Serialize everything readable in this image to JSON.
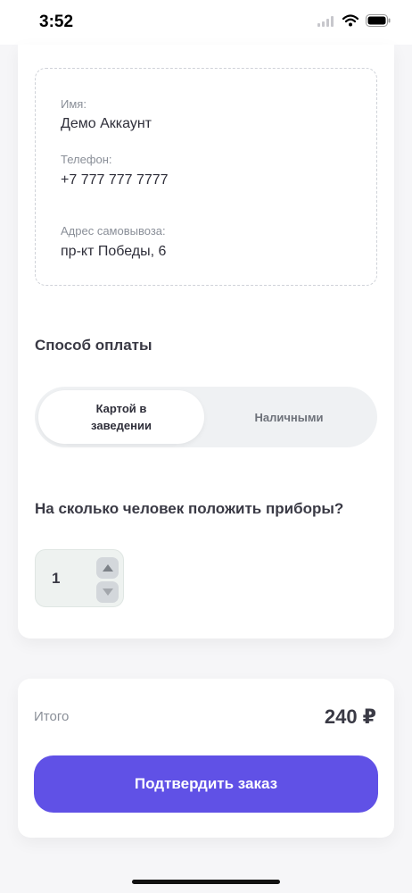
{
  "status_bar": {
    "time": "3:52"
  },
  "customer": {
    "name_label": "Имя:",
    "name_value": "Демо Аккаунт",
    "phone_label": "Телефон:",
    "phone_value": "+7 777 777 7777",
    "address_label": "Адрес самовывоза:",
    "address_value": "пр-кт Победы, 6"
  },
  "payment": {
    "title": "Способ оплаты",
    "options": [
      {
        "line1": "Картой в",
        "line2": "заведении",
        "selected": true
      },
      {
        "label": "Наличными",
        "selected": false
      }
    ]
  },
  "cutlery": {
    "question": "На сколько человек положить приборы?",
    "count": "1"
  },
  "summary": {
    "total_label": "Итого",
    "total_value": "240 ₽",
    "confirm_label": "Подтвердить заказ"
  },
  "colors": {
    "accent": "#6051e6",
    "toggle_bg": "#eff1f3"
  }
}
